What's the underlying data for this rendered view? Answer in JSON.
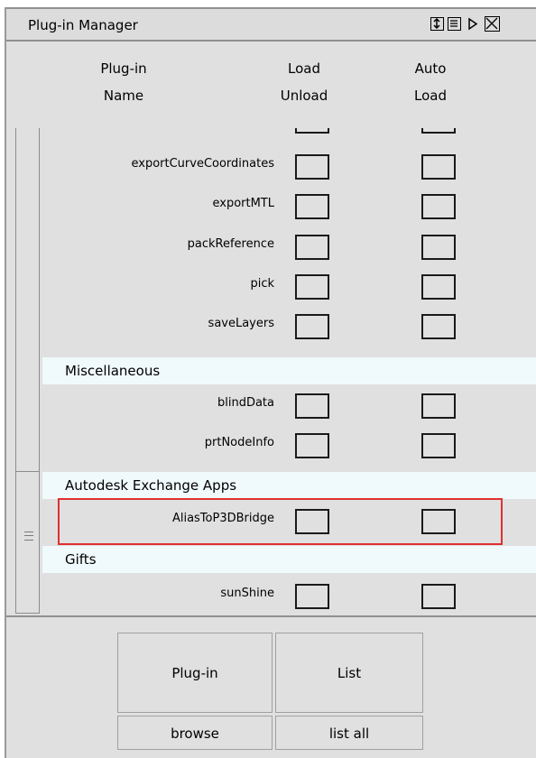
{
  "window": {
    "title": "Plug-in Manager"
  },
  "titlebar_icons": [
    "resize-icon",
    "menu-icon",
    "collapse-arrow-icon",
    "close-icon"
  ],
  "headers": {
    "name": [
      "Plug-in",
      "Name"
    ],
    "load": [
      "Load",
      "Unload"
    ],
    "auto": [
      "Auto",
      "Load"
    ]
  },
  "plugins": [
    {
      "name": "exportCurveCoordinates",
      "loaded": false,
      "autoload": false
    },
    {
      "name": "exportMTL",
      "loaded": false,
      "autoload": false
    },
    {
      "name": "packReference",
      "loaded": false,
      "autoload": false
    },
    {
      "name": "pick",
      "loaded": false,
      "autoload": false
    },
    {
      "name": "saveLayers",
      "loaded": false,
      "autoload": false
    }
  ],
  "groups": [
    {
      "label": "Miscellaneous",
      "items": [
        {
          "name": "blindData"
        },
        {
          "name": "prtNodeInfo"
        }
      ]
    },
    {
      "label": "Autodesk Exchange Apps",
      "items": [
        {
          "name": "AliasToP3DBridge"
        }
      ]
    },
    {
      "label": "Gifts",
      "items": [
        {
          "name": "sunShine"
        }
      ]
    }
  ],
  "buttons": {
    "plugin": "Plug-in",
    "list": "List",
    "browse": "browse",
    "list_all": "list all"
  }
}
